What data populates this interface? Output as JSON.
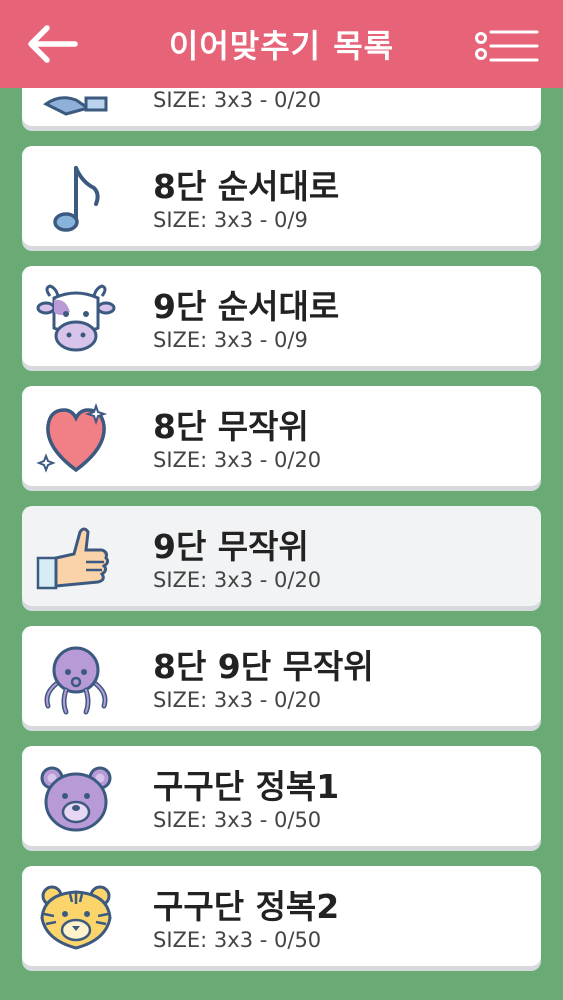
{
  "header": {
    "title": "이어맞추기 목록",
    "back_icon": "arrow-left-icon",
    "menu_icon": "list-menu-icon"
  },
  "levels": [
    {
      "name": "",
      "size": "SIZE: 3x3 - 0/20",
      "icon": "cut-off-icon"
    },
    {
      "name": "8단 순서대로",
      "size": "SIZE: 3x3 - 0/9",
      "icon": "music-note-icon"
    },
    {
      "name": "9단 순서대로",
      "size": "SIZE: 3x3 - 0/9",
      "icon": "cow-icon"
    },
    {
      "name": "8단 무작위",
      "size": "SIZE: 3x3 - 0/20",
      "icon": "heart-sparkle-icon"
    },
    {
      "name": "9단 무작위",
      "size": "SIZE: 3x3 - 0/20",
      "icon": "thumbs-up-icon"
    },
    {
      "name": "8단 9단 무작위",
      "size": "SIZE: 3x3 - 0/20",
      "icon": "octopus-icon"
    },
    {
      "name": "구구단 정복1",
      "size": "SIZE: 3x3 - 0/50",
      "icon": "bear-icon"
    },
    {
      "name": "구구단 정복2",
      "size": "SIZE: 3x3 - 0/50",
      "icon": "tiger-icon"
    }
  ],
  "colors": {
    "header": "#e66378",
    "background": "#6aab75",
    "card": "#ffffff",
    "selected_card": "#f2f3f4"
  }
}
